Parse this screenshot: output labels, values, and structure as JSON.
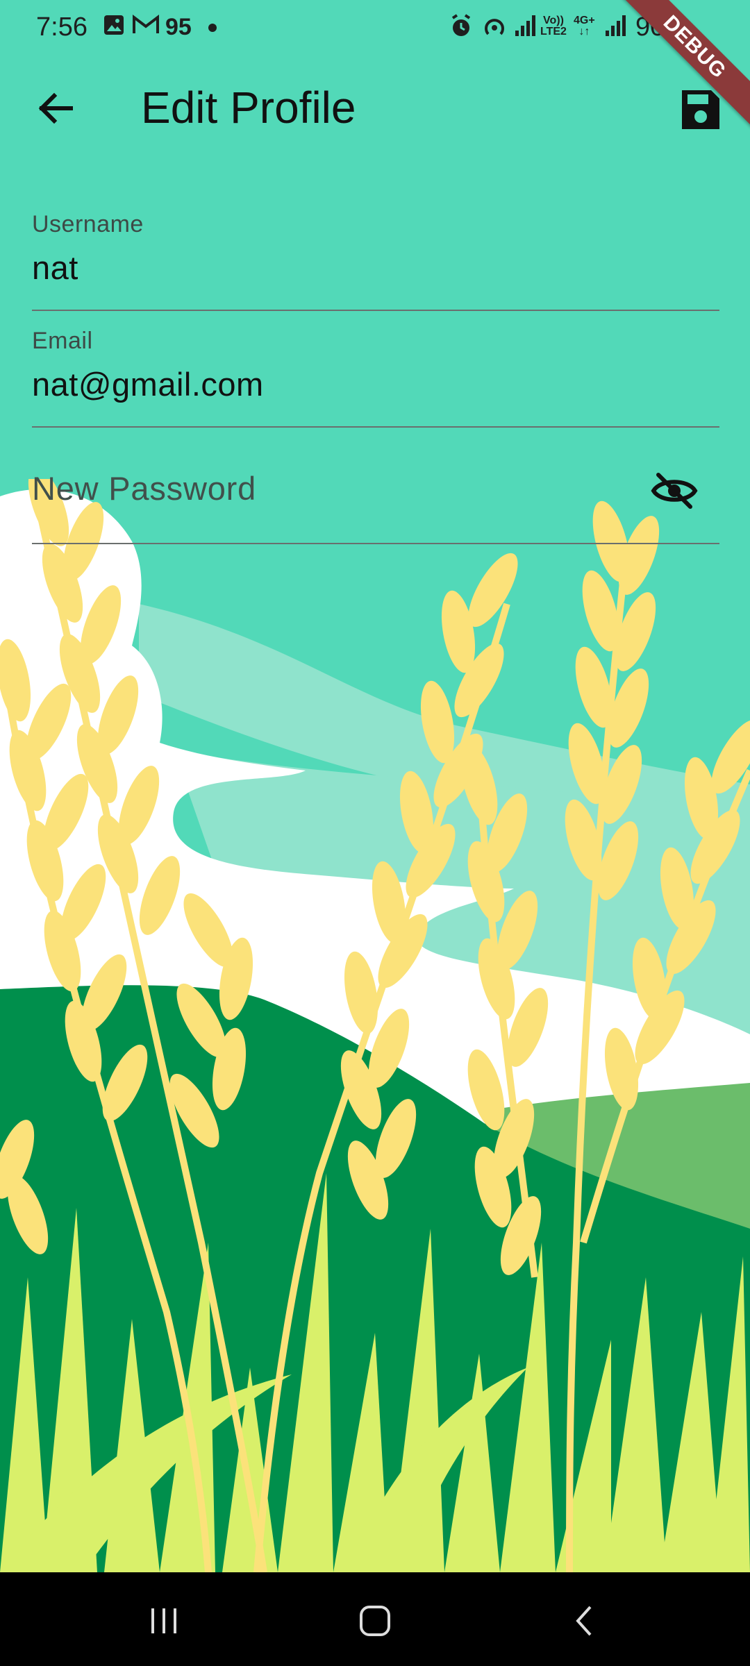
{
  "status_bar": {
    "time": "7:56",
    "notification_count": "95",
    "network_lte_line1": "Vo))",
    "network_lte_line2": "LTE2",
    "network_4g": "4G+",
    "battery": "90%"
  },
  "debug_banner": "DEBUG",
  "app_bar": {
    "title": "Edit Profile",
    "back_icon": "arrow-left-icon",
    "save_icon": "save-floppy-icon"
  },
  "form": {
    "username": {
      "label": "Username",
      "value": "nat"
    },
    "email": {
      "label": "Email",
      "value": "nat@gmail.com"
    },
    "password": {
      "placeholder": "New Password",
      "toggle_icon": "visibility-off-icon"
    }
  },
  "nav_bar": {
    "recents_icon": "recents-icon",
    "home_icon": "home-icon",
    "back_icon": "back-chevron-icon"
  },
  "colors": {
    "background": "#52d9b8",
    "hill_dark": "#008f4c",
    "hill_light": "#6bbd6b",
    "wheat": "#fbe27a",
    "grass": "#d9f06a",
    "cloud": "#ffffff"
  }
}
